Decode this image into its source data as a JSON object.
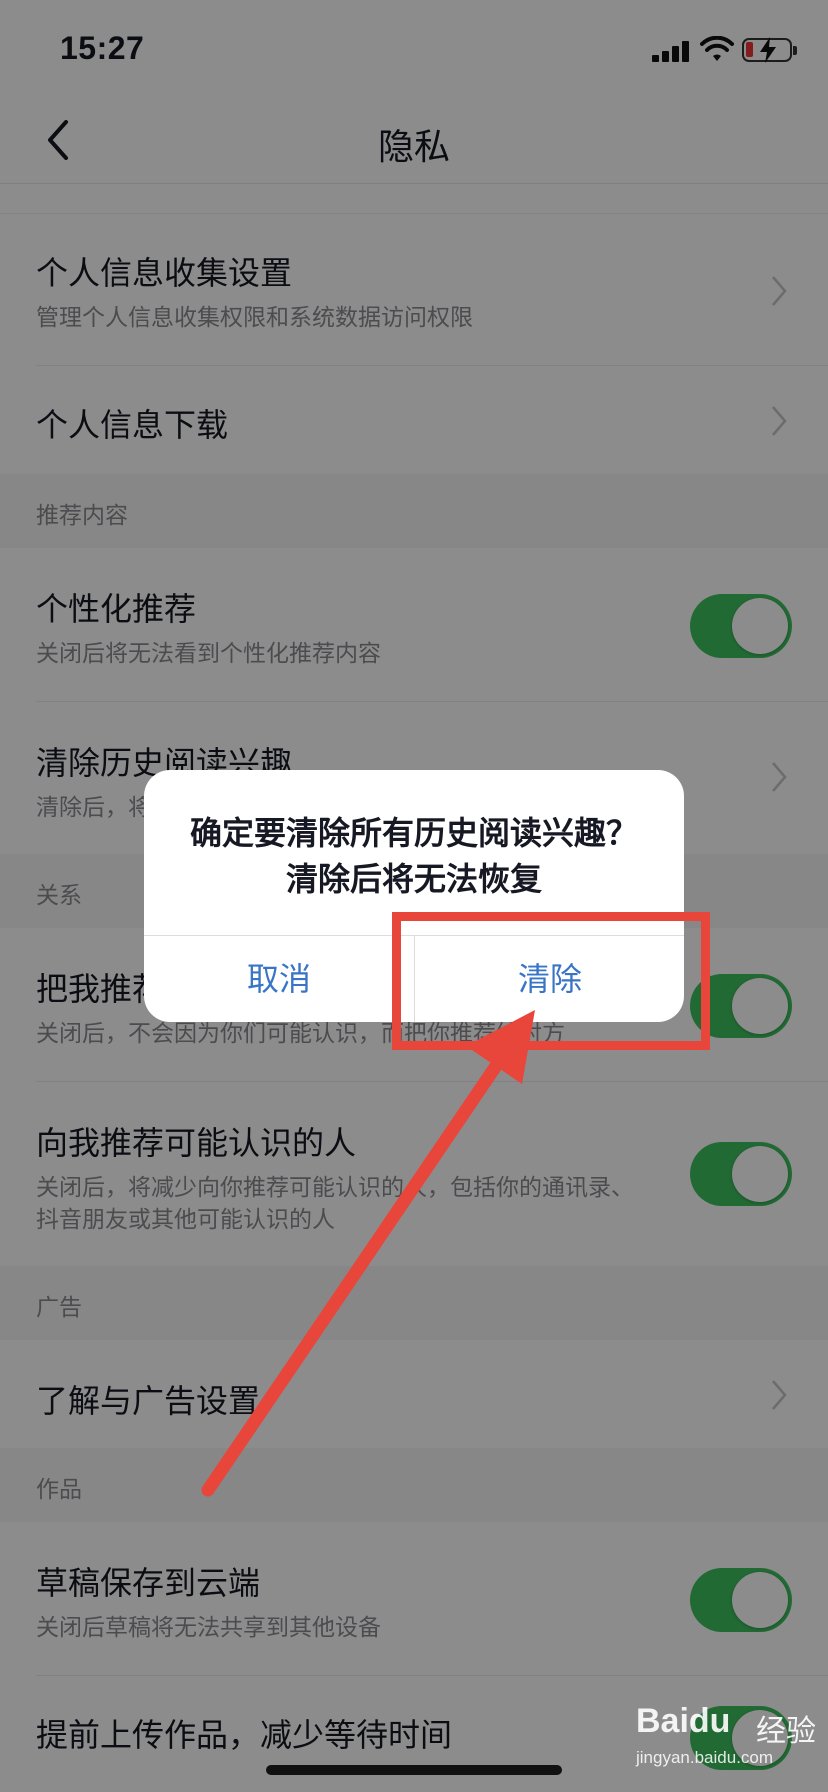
{
  "status_bar": {
    "time": "15:27"
  },
  "nav": {
    "title": "隐私"
  },
  "list": {
    "collect": {
      "title": "个人信息收集设置",
      "subtitle": "管理个人信息收集权限和系统数据访问权限"
    },
    "download": {
      "title": "个人信息下载"
    },
    "section_recommend": "推荐内容",
    "personalized": {
      "title": "个性化推荐",
      "subtitle": "关闭后将无法看到个性化推荐内容",
      "on": true
    },
    "clear_interest": {
      "title": "清除历史阅读兴趣",
      "subtitle": "清除后，将"
    },
    "section_relation": "关系",
    "recommend_me": {
      "title": "把我推荐",
      "subtitle": "关闭后，不会因为你们可能认识，而把你推荐给对方",
      "on": true
    },
    "recommend_people": {
      "title": "向我推荐可能认识的人",
      "subtitle": "关闭后，将减少向你推荐可能认识的人，包括你的通讯录、抖音朋友或其他可能认识的人",
      "on": true
    },
    "section_ads": "广告",
    "ads": {
      "title": "了解与广告设置"
    },
    "section_works": "作品",
    "cloud_draft": {
      "title": "草稿保存到云端",
      "subtitle": "关闭后草稿将无法共享到其他设备",
      "on": true
    },
    "pre_upload": {
      "title": "提前上传作品，减少等待时间",
      "on": true
    }
  },
  "dialog": {
    "message": "确定要清除所有历史阅读兴趣？清除后将无法恢复",
    "cancel_label": "取消",
    "confirm_label": "清除"
  },
  "watermark": {
    "logo": "Baidu",
    "text": "经验",
    "url": "jingyan.baidu.com"
  },
  "colors": {
    "accent_blue": "#3975c6",
    "toggle_green": "#3fc160",
    "annotation_red": "#e8463a"
  }
}
